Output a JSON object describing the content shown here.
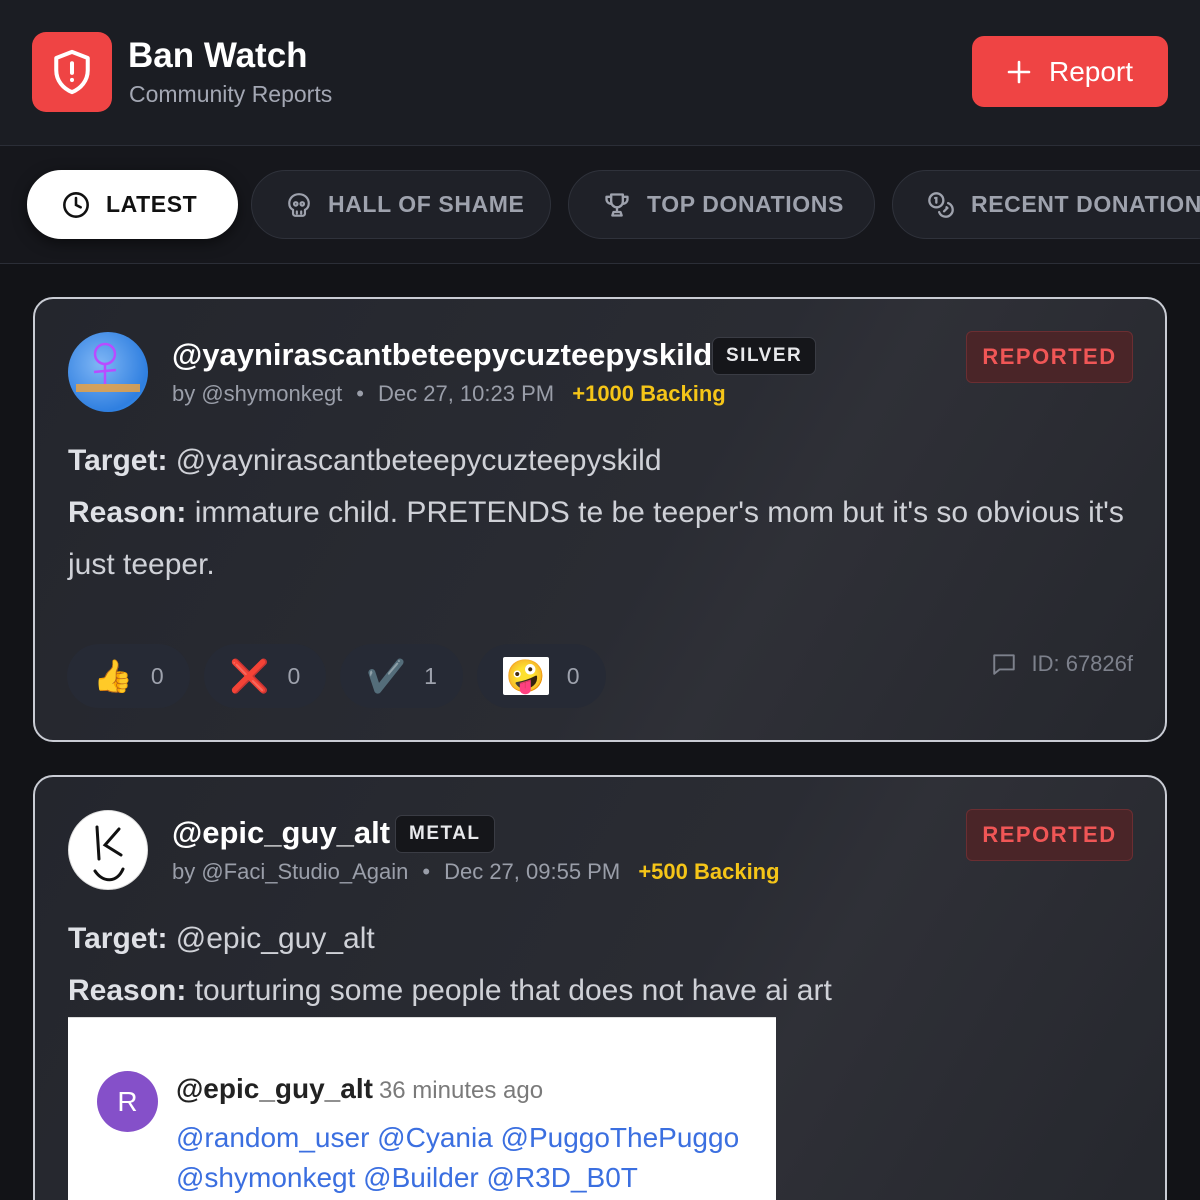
{
  "app": {
    "title": "Ban Watch",
    "subtitle": "Community Reports",
    "report_button": "Report",
    "logo_icon": "shield-alert-icon",
    "accent": "#ef4444"
  },
  "tabs": [
    {
      "label": "LATEST",
      "icon": "clock-icon",
      "active": true
    },
    {
      "label": "HALL OF SHAME",
      "icon": "skull-icon",
      "active": false
    },
    {
      "label": "TOP DONATIONS",
      "icon": "trophy-icon",
      "active": false
    },
    {
      "label": "RECENT DONATIONS",
      "icon": "coins-icon",
      "active": false
    }
  ],
  "reports": [
    {
      "username": "@yaynirascantbeteepycuzteepyskild",
      "tier": "SILVER",
      "by": "by @shymonkegt",
      "date": "Dec 27, 10:23 PM",
      "backing": "+1000 Backing",
      "status": "REPORTED",
      "target_label": "Target:",
      "target": "@yaynirascantbeteepycuzteepyskild",
      "reason_label": "Reason:",
      "reason": "immature child. PRETENDS te be teeper's mom but it's so obvious it's just teeper.",
      "reactions": [
        {
          "emoji": "👍",
          "count": "0"
        },
        {
          "emoji": "❌",
          "count": "0"
        },
        {
          "emoji": "✔️",
          "count": "1"
        },
        {
          "emoji": "🤪",
          "count": "0"
        }
      ],
      "id": "ID: 67826f"
    },
    {
      "username": "@epic_guy_alt",
      "tier": "METAL",
      "by": "by @Faci_Studio_Again",
      "date": "Dec 27, 09:55 PM",
      "backing": "+500 Backing",
      "status": "REPORTED",
      "target_label": "Target:",
      "target": "@epic_guy_alt",
      "reason_label": "Reason:",
      "reason": "tourturing some people that does not have ai art",
      "attachment": {
        "avatar_letter": "R",
        "user": "@epic_guy_alt",
        "time": "36 minutes ago",
        "mentions": "@random_user @Cyania @PuggoThePuggo @shymonkegt @Builder @R3D_B0T"
      }
    }
  ]
}
